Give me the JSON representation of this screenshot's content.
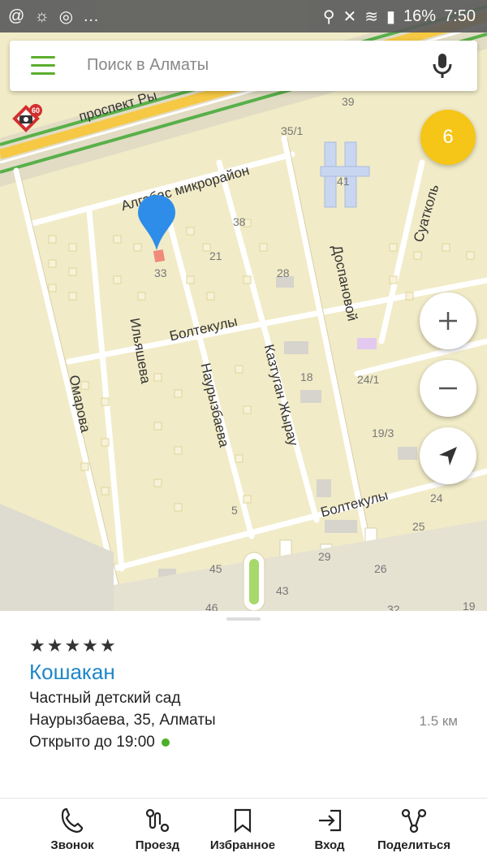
{
  "status_bar": {
    "battery": "16%",
    "time": "7:50"
  },
  "search": {
    "placeholder": "Поиск в Алматы"
  },
  "map": {
    "streets": [
      {
        "name": "проспект Ры"
      },
      {
        "name": "Алгабас микрорайон"
      },
      {
        "name": "Суатколь"
      },
      {
        "name": "Доспановой"
      },
      {
        "name": "Болтекулы"
      },
      {
        "name": "Ильяшева"
      },
      {
        "name": "Наурызбаева"
      },
      {
        "name": "Казтуган Жырау"
      },
      {
        "name": "Омарова"
      },
      {
        "name": "Болтекулы"
      }
    ],
    "house_numbers": [
      "39",
      "35/1",
      "41",
      "38",
      "21",
      "33",
      "28",
      "18",
      "24/1",
      "19/3",
      "24",
      "25",
      "29",
      "26",
      "45",
      "43",
      "46",
      "32",
      "19",
      "5"
    ],
    "cluster_count": "6",
    "speed_camera_limit": "60"
  },
  "place": {
    "rating_stars": "★★★★★",
    "name": "Кошакан",
    "category": "Частный детский сад",
    "address": "Наурызбаева, 35, Алматы",
    "distance": "1.5 км",
    "hours": "Открыто до 19:00",
    "open_color": "#4caf2a"
  },
  "actions": {
    "call": "Звонок",
    "route": "Проезд",
    "favorites": "Избранное",
    "entrance": "Вход",
    "share": "Поделиться"
  },
  "colors": {
    "accent_blue": "#1e87c8",
    "menu_green": "#5bae2d",
    "cluster_yellow": "#f5c518"
  }
}
